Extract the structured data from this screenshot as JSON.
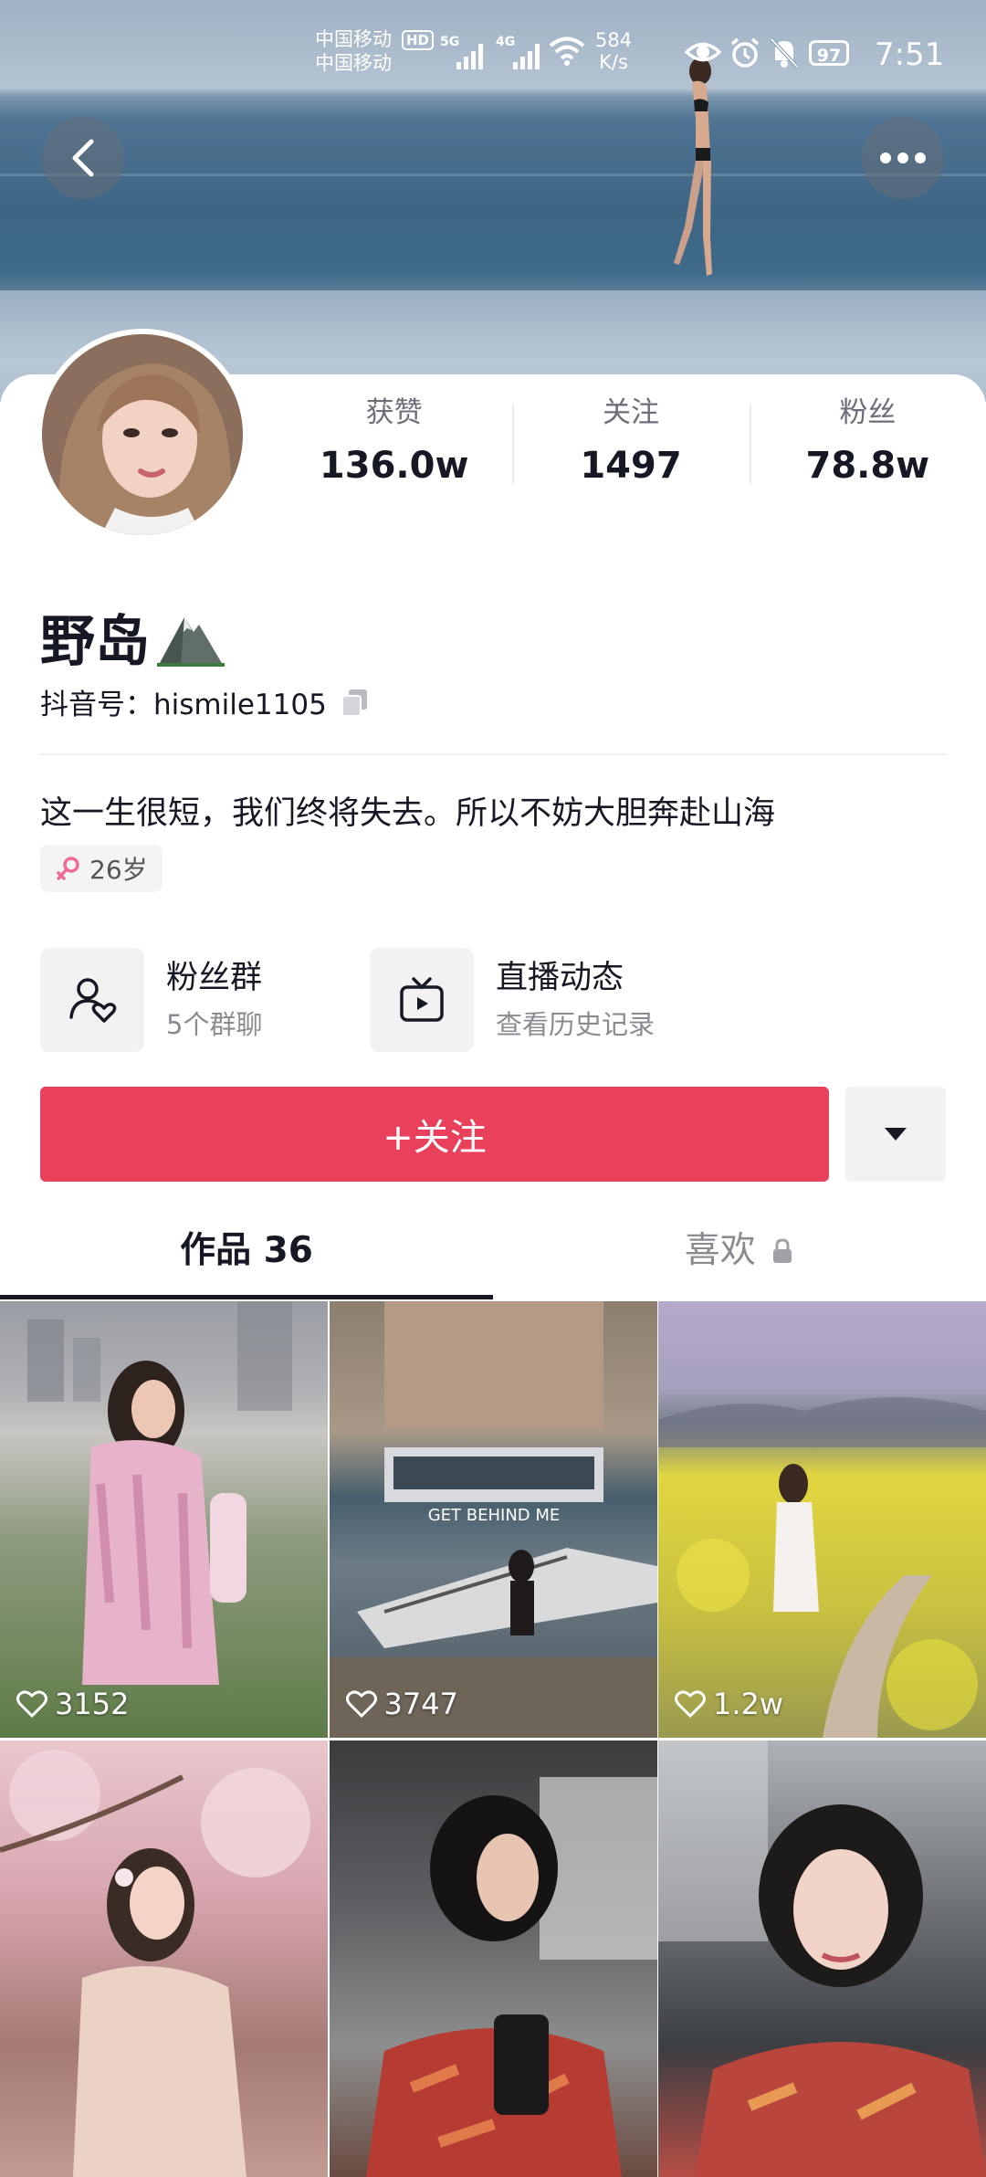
{
  "status_bar": {
    "carrier_1": "中国移动",
    "carrier_2": "中国移动",
    "hd": "HD",
    "net_1": "5G",
    "net_2": "4G",
    "speed_value": "584",
    "speed_unit": "K/s",
    "battery": "97",
    "time": "7:51"
  },
  "profile": {
    "name": "野岛",
    "name_emoji_icon": "mountain-icon",
    "id_label": "抖音号：",
    "id_value": "hismile1105",
    "bio": "这一生很短，我们终将失去。所以不妨大胆奔赴山海",
    "tag": "26岁"
  },
  "stats": [
    {
      "label": "获赞",
      "value": "136.0w"
    },
    {
      "label": "关注",
      "value": "1497"
    },
    {
      "label": "粉丝",
      "value": "78.8w"
    }
  ],
  "entries": [
    {
      "title": "粉丝群",
      "subtitle": "5个群聊",
      "icon": "fan-group-icon"
    },
    {
      "title": "直播动态",
      "subtitle": "查看历史记录",
      "icon": "live-tv-icon"
    }
  ],
  "actions": {
    "follow": "+关注"
  },
  "tabs": [
    {
      "label": "作品 36"
    },
    {
      "label": "喜欢"
    }
  ],
  "videos": [
    {
      "likes": "3152",
      "overlay_text": ""
    },
    {
      "likes": "3747",
      "overlay_text": "GET BEHIND ME"
    },
    {
      "likes": "1.2w",
      "overlay_text": ""
    },
    {
      "likes": "",
      "overlay_text": ""
    },
    {
      "likes": "",
      "overlay_text": ""
    },
    {
      "likes": "",
      "overlay_text": ""
    }
  ],
  "colors": {
    "follow_button": "#e9415b",
    "text_primary": "#161823",
    "text_secondary": "#8a8b91"
  }
}
